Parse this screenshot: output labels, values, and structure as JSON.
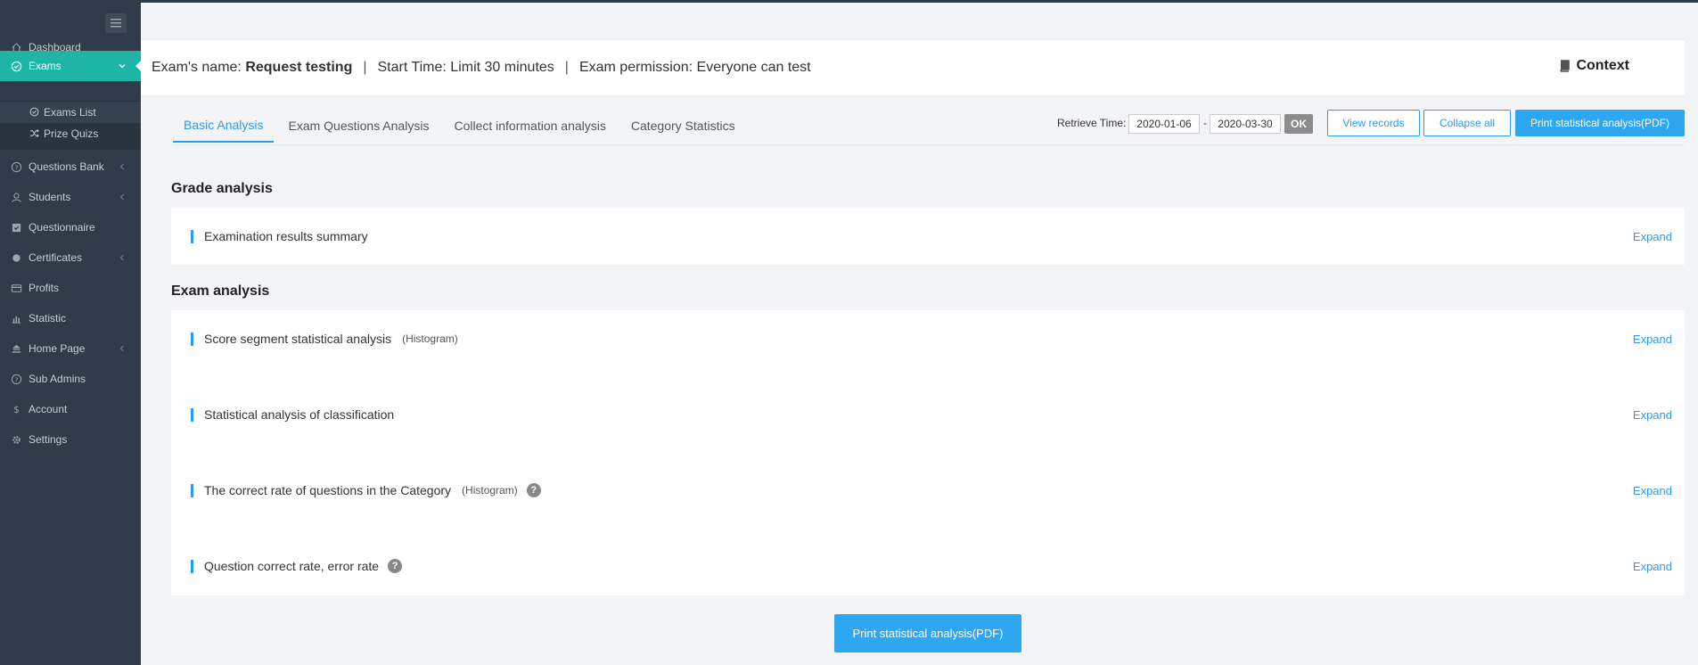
{
  "sidebar": {
    "items": [
      {
        "label": "Dashboard",
        "icon": "home-icon"
      },
      {
        "label": "Exams",
        "icon": "check-circle-icon",
        "active": true
      },
      {
        "label": "Questions Bank",
        "icon": "question-circle-icon"
      },
      {
        "label": "Students",
        "icon": "user-icon"
      },
      {
        "label": "Questionnaire",
        "icon": "checkbox-icon"
      },
      {
        "label": "Certificates",
        "icon": "dot-icon"
      },
      {
        "label": "Profits",
        "icon": "card-icon"
      },
      {
        "label": "Statistic",
        "icon": "bar-chart-icon"
      },
      {
        "label": "Home Page",
        "icon": "home-page-icon"
      },
      {
        "label": "Sub Admins",
        "icon": "question-circle-icon"
      },
      {
        "label": "Account",
        "icon": "dollar-icon"
      },
      {
        "label": "Settings",
        "icon": "gear-icon"
      }
    ],
    "sub_items": [
      {
        "label": "Exams List",
        "icon": "check-circle-icon"
      },
      {
        "label": "Prize Quizs",
        "icon": "shuffle-icon"
      }
    ]
  },
  "header": {
    "name_label": "Exam's name:",
    "name_value": "Request testing",
    "separator": "|",
    "start_time": "Start Time: Limit 30 minutes",
    "permission": "Exam permission: Everyone can test",
    "context_label": "Context"
  },
  "tabs": [
    {
      "label": "Basic Analysis",
      "active": true
    },
    {
      "label": "Exam Questions Analysis"
    },
    {
      "label": "Collect information analysis"
    },
    {
      "label": "Category Statistics"
    }
  ],
  "toolbar": {
    "retrieve_label": "Retrieve Time:",
    "date_from": "2020-01-06",
    "date_to": "2020-03-30",
    "dash": "-",
    "ok_label": "OK",
    "view_records": "View records",
    "collapse_all": "Collapse all",
    "print_pdf": "Print statistical analysis(PDF)"
  },
  "sections": {
    "grade_title": "Grade analysis",
    "grade_rows": [
      {
        "label": "Examination results summary",
        "expand": "Expand"
      }
    ],
    "exam_title": "Exam analysis",
    "exam_rows": [
      {
        "label": "Score segment statistical analysis",
        "note": "(Histogram)",
        "expand": "Expand"
      },
      {
        "label": "Statistical analysis of classification",
        "expand": "Expand"
      },
      {
        "label": "The correct rate of questions in the Category",
        "note": "(Histogram)",
        "help": "?",
        "expand": "Expand"
      },
      {
        "label": "Question correct rate, error rate",
        "help": "?",
        "expand": "Expand"
      }
    ]
  },
  "footer": {
    "print_pdf": "Print statistical analysis(PDF)"
  },
  "colors": {
    "sidebar_bg": "#2f3b48",
    "active_menu": "#1fb5a6",
    "accent_blue": "#2e9be8",
    "primary_btn": "#2ea6f2"
  }
}
